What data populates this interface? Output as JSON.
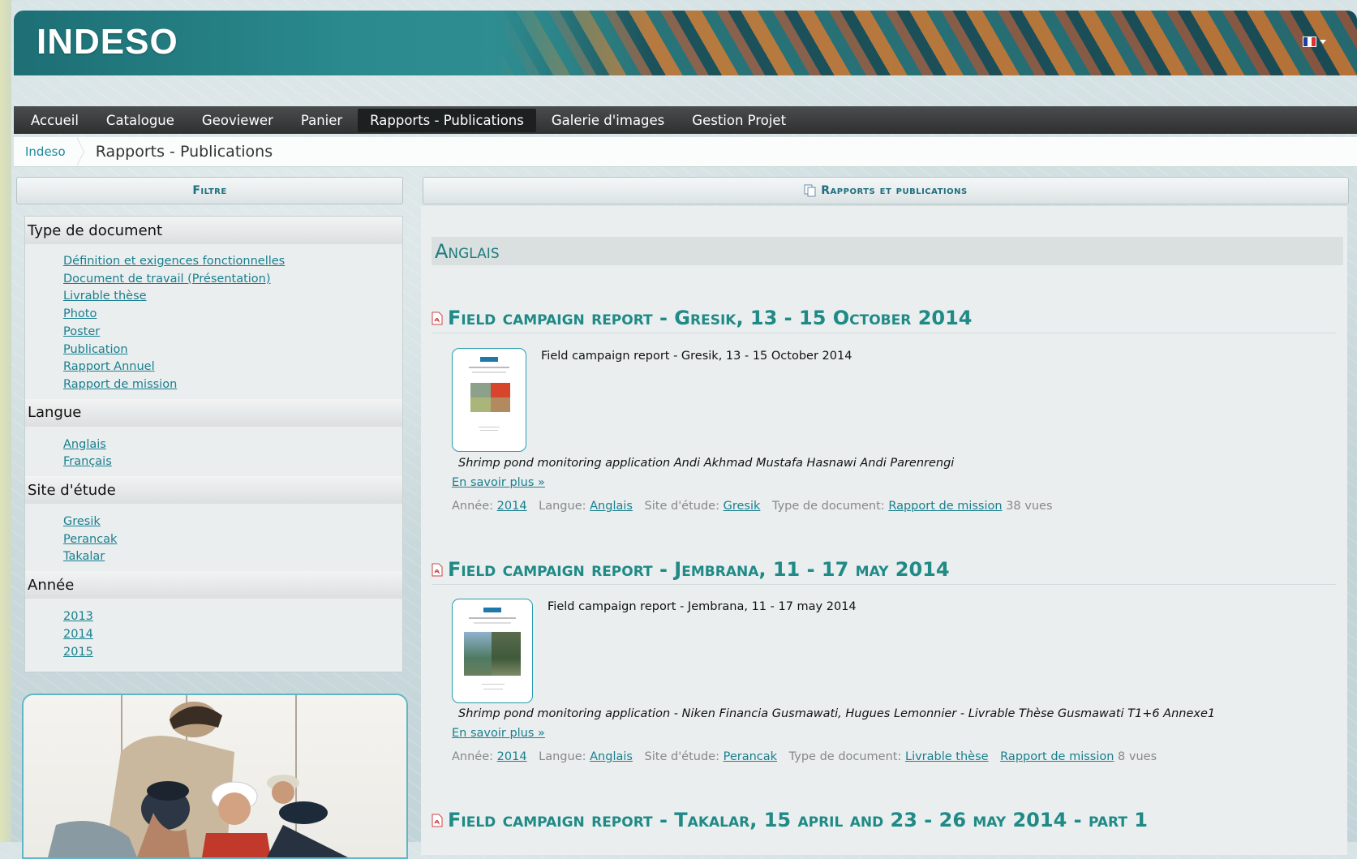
{
  "header": {
    "logo": "INDESO"
  },
  "nav": {
    "items": [
      "Accueil",
      "Catalogue",
      "Geoviewer",
      "Panier",
      "Rapports - Publications",
      "Galerie d'images",
      "Gestion Projet"
    ],
    "active": 4
  },
  "breadcrumb": {
    "home": "Indeso",
    "current": "Rapports - Publications"
  },
  "filter": {
    "title": "Filtre",
    "facets": [
      {
        "title": "Type de document",
        "items": [
          "Définition et exigences fonctionnelles",
          "Document de travail (Présentation)",
          "Livrable thèse",
          "Photo",
          "Poster",
          "Publication",
          "Rapport Annuel",
          "Rapport de mission"
        ]
      },
      {
        "title": "Langue",
        "items": [
          "Anglais",
          "Français"
        ]
      },
      {
        "title": "Site d'étude",
        "items": [
          "Gresik",
          "Perancak",
          "Takalar"
        ]
      },
      {
        "title": "Année",
        "items": [
          "2013",
          "2014",
          "2015"
        ]
      }
    ]
  },
  "main": {
    "panel_title": "Rapports et publications",
    "section_title": "Anglais",
    "labels": {
      "year": "Année:",
      "lang": "Langue:",
      "site": "Site d'étude:",
      "type": "Type de document:"
    },
    "publications": [
      {
        "title": "Field campaign report - Gresik, 13 - 15 October 2014",
        "caption": "Field campaign report - Gresik, 13 - 15 October 2014",
        "abstract": "Shrimp pond monitoring application Andi Akhmad Mustafa Hasnawi Andi Parenrengi",
        "more": "En savoir plus »",
        "year": "2014",
        "lang": "Anglais",
        "site": "Gresik",
        "types": [
          "Rapport de mission"
        ],
        "views": "38 vues"
      },
      {
        "title": "Field campaign report - Jembrana, 11 - 17 may 2014",
        "caption": "Field campaign report - Jembrana, 11 - 17 may 2014",
        "abstract": "Shrimp pond monitoring application - Niken Financia Gusmawati, Hugues Lemonnier - Livrable Thèse Gusmawati T1+6 Annexe1",
        "more": "En savoir plus »",
        "year": "2014",
        "lang": "Anglais",
        "site": "Perancak",
        "types": [
          "Livrable thèse",
          "Rapport de mission"
        ],
        "views": "8 vues"
      },
      {
        "title": "Field campaign report - Takalar, 15 april and 23 - 26 may 2014 - part 1"
      }
    ]
  },
  "colors": {
    "accent": "#1f8a86",
    "link": "#1a7f8e",
    "nav": "#2e3031"
  }
}
